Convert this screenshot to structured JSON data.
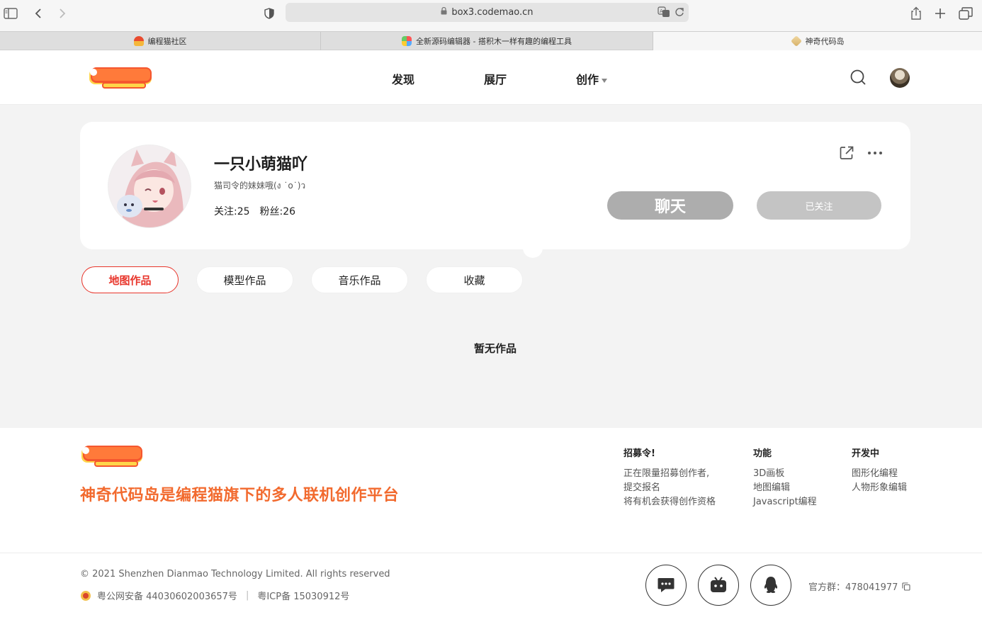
{
  "browser": {
    "url": "box3.codemao.cn",
    "tabs": [
      {
        "label": "编程猫社区"
      },
      {
        "label": "全新源码编辑器 - 搭积木一样有趣的编程工具"
      },
      {
        "label": "神奇代码岛"
      }
    ]
  },
  "header": {
    "nav": [
      {
        "label": "发现"
      },
      {
        "label": "展厅"
      },
      {
        "label": "创作"
      }
    ]
  },
  "profile": {
    "username": "一只小萌猫吖",
    "bio": "猫司令的妹妹哦(ง ˙o˙)ว",
    "following": "关注:25",
    "followers": "粉丝:26",
    "chat_label": "聊天",
    "follow_label": "已关注"
  },
  "work_tabs": [
    {
      "label": "地图作品"
    },
    {
      "label": "模型作品"
    },
    {
      "label": "音乐作品"
    },
    {
      "label": "收藏"
    }
  ],
  "empty_text": "暂无作品",
  "footer": {
    "slogan": "神奇代码岛是编程猫旗下的多人联机创作平台",
    "columns": [
      {
        "title": "招募令!",
        "lines": [
          "正在限量招募创作者,",
          "提交报名",
          "将有机会获得创作资格"
        ]
      },
      {
        "title": "功能",
        "lines": [
          "3D画板",
          "地图编辑",
          "Javascript编程"
        ]
      },
      {
        "title": "开发中",
        "lines": [
          "图形化编程",
          "人物形象编辑"
        ]
      }
    ],
    "copyright": "© 2021 Shenzhen Dianmao Technology Limited. All rights reserved",
    "police_record": "粤公网安备 44030602003657号",
    "icp_record": "粤ICP备 15030912号",
    "qq_group": "官方群：478041977"
  },
  "colors": {
    "accent": "#e8352b",
    "slogan": "#f26a2e",
    "chat_button": "#adadad",
    "follow_button": "#c4c4c4"
  }
}
